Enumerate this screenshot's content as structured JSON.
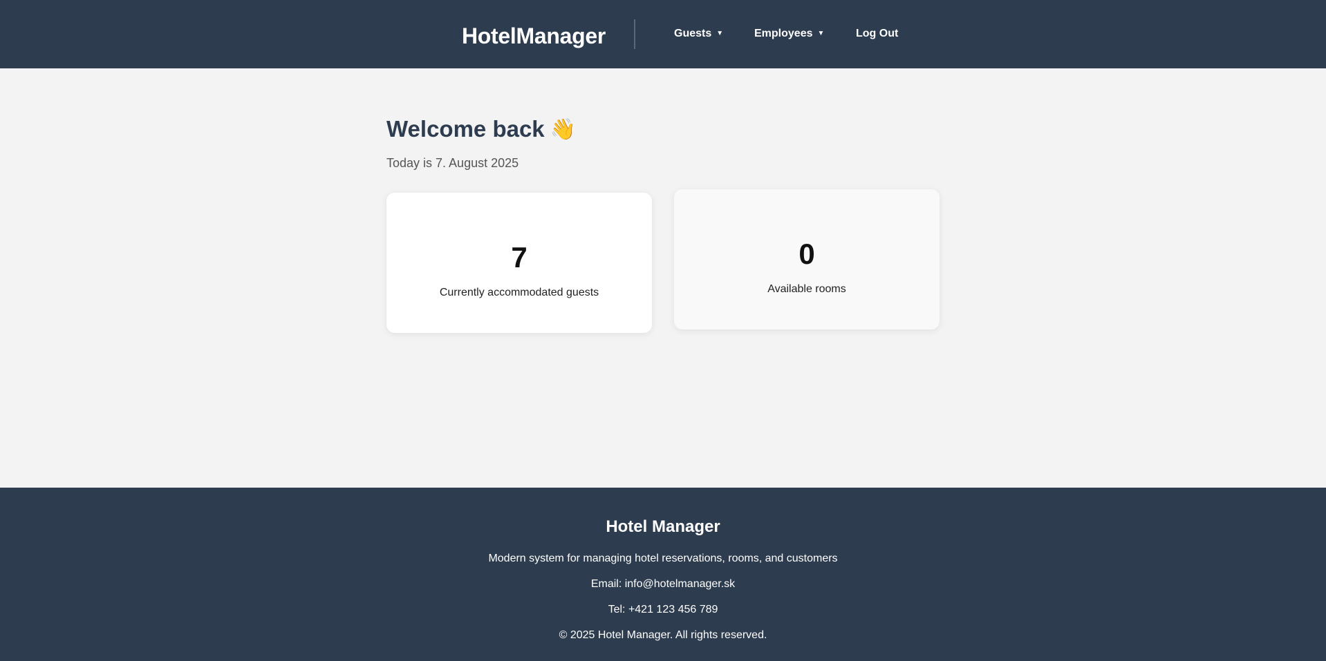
{
  "header": {
    "brand": "HotelManager",
    "nav": {
      "guests": "Guests",
      "employees": "Employees",
      "logout": "Log Out"
    },
    "dropdown_glyph": "▼"
  },
  "main": {
    "welcome": "Welcome back",
    "wave_emoji": "👋",
    "today": "Today is 7. August 2025",
    "stats": {
      "guests": {
        "value": "7",
        "label": "Currently accommodated guests"
      },
      "rooms": {
        "value": "0",
        "label": "Available rooms"
      }
    }
  },
  "footer": {
    "title": "Hotel Manager",
    "description": "Modern system for managing hotel reservations, rooms, and customers",
    "email": "Email: info@hotelmanager.sk",
    "tel": "Tel: +421 123 456 789",
    "copyright": "© 2025 Hotel Manager. All rights reserved."
  },
  "colors": {
    "header_bg": "#2d3c4f",
    "page_bg": "#f3f3f3",
    "card_bg": "#ffffff",
    "heading": "#2d3c4f"
  }
}
